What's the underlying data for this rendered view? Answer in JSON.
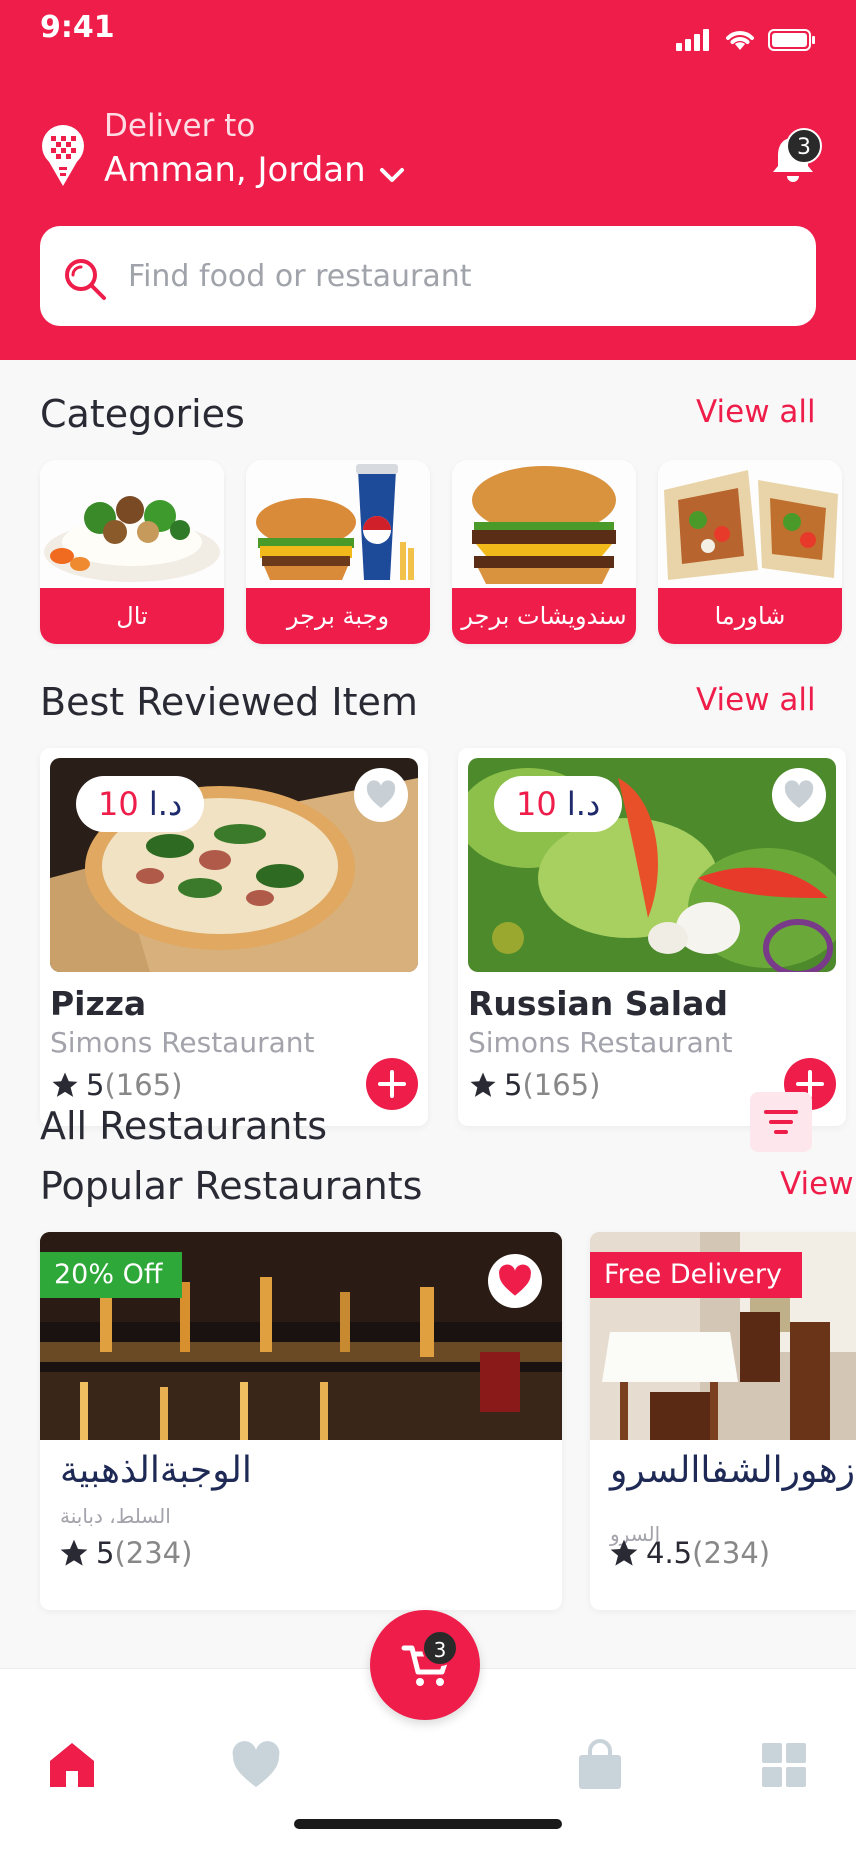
{
  "status_bar": {
    "time": "9:41"
  },
  "header": {
    "deliver_label": "Deliver to",
    "city": "Amman, Jordan",
    "notification_count": "3",
    "brand_color": "#ee1d4a"
  },
  "search": {
    "placeholder": "Find food or restaurant"
  },
  "categories": {
    "title": "Categories",
    "view_all": "View all",
    "items": [
      {
        "label": "تال",
        "icon": "rice-plate-image"
      },
      {
        "label": "وجبة برجر",
        "icon": "burger-meal-image"
      },
      {
        "label": "سندويشات برجر",
        "icon": "burger-sandwich-image"
      },
      {
        "label": "شاورما",
        "icon": "shawarma-image"
      }
    ]
  },
  "best_reviewed": {
    "title": "Best Reviewed Item",
    "view_all": "View all",
    "items": [
      {
        "name": "Pizza",
        "restaurant": "Simons Restaurant",
        "price": "10",
        "currency": "د.ا",
        "rating": "5",
        "reviews": "(165)"
      },
      {
        "name": "Russian Salad",
        "restaurant": "Simons Restaurant",
        "price": "10",
        "currency": "د.ا",
        "rating": "5",
        "reviews": "(165)"
      }
    ]
  },
  "all_restaurants": {
    "title": "All Restaurants"
  },
  "popular": {
    "title": "Popular Restaurants",
    "view_all": "View",
    "items": [
      {
        "badge": "20% Off",
        "badge_color": "#2fa83a",
        "name": "الوجبةالذهبية",
        "sub": "السلط، دبابنة",
        "rating": "5",
        "reviews": "(234)",
        "favorited": true
      },
      {
        "badge": "Free Delivery",
        "badge_color": "#ee1d4a",
        "name": "زهورالشفاالسرو",
        "sub": "السرو",
        "rating": "4.5",
        "reviews": "(234)",
        "favorited": false
      }
    ]
  },
  "cart": {
    "count": "3"
  },
  "bottom_nav": {
    "items": [
      "home-icon",
      "heart-icon",
      "bag-icon",
      "grid-icon"
    ]
  }
}
